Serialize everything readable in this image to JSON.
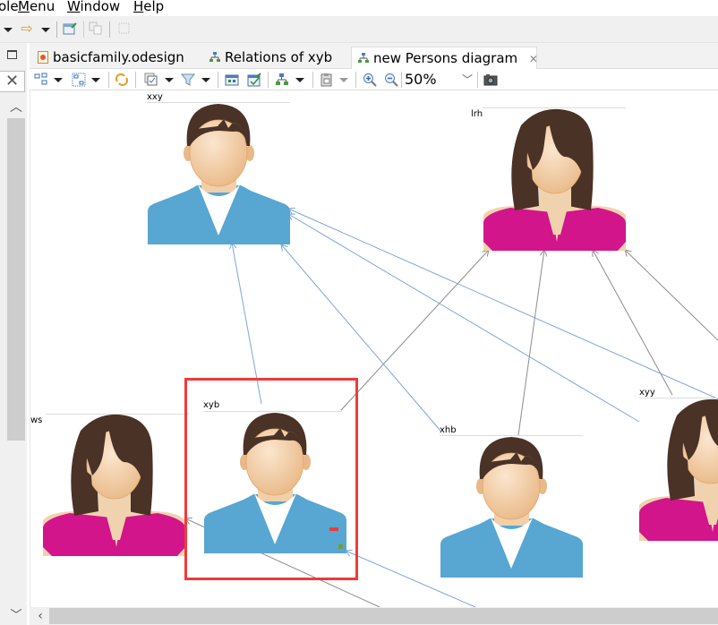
{
  "menu": {
    "items": [
      {
        "label": "ole",
        "prefix": "",
        "underline": "",
        "rest": "ole"
      },
      {
        "label": "Menu",
        "prefix": "",
        "underline": "M",
        "rest": "enu"
      },
      {
        "label": "Window",
        "prefix": "",
        "underline": "W",
        "rest": "indow"
      },
      {
        "label": "Help",
        "prefix": "",
        "underline": "H",
        "rest": "elp"
      }
    ]
  },
  "main_toolbar": {
    "icons": [
      "dropdown-arrow",
      "forward-arrow-icon",
      "dropdown-arrow",
      "new-window-icon",
      "copy-disabled-icon",
      "selection-disabled-icon"
    ]
  },
  "editor_tabs": [
    {
      "label": "basicfamily.odesign",
      "icon": "odesign-file-icon",
      "active": false
    },
    {
      "label": "Relations of xyb",
      "icon": "diagram-icon",
      "active": false
    },
    {
      "label": "new Persons diagram",
      "icon": "diagram-icon",
      "active": true,
      "close": "✕"
    }
  ],
  "diagram_toolbar": {
    "zoom_level": "50%",
    "icons": [
      "arrange-all-icon",
      "arrange-selection-icon",
      "refresh-icon",
      "select-elements-icon",
      "filters-icon",
      "layers-icon",
      "pin-icon",
      "layout-icon",
      "copy-format-icon",
      "zoom-in-icon",
      "zoom-out-icon",
      "export-image-icon"
    ]
  },
  "left_panel": {
    "close_label": "✕"
  },
  "diagram": {
    "nodes": [
      {
        "id": "xxy",
        "label": "xxy",
        "gender": "male",
        "selected": false
      },
      {
        "id": "lrh",
        "label": "lrh",
        "gender": "female",
        "selected": false
      },
      {
        "id": "ws",
        "label": "ws",
        "gender": "female",
        "selected": false
      },
      {
        "id": "xyb",
        "label": "xyb",
        "gender": "male",
        "selected": true
      },
      {
        "id": "xhb",
        "label": "xhb",
        "gender": "male",
        "selected": false
      },
      {
        "id": "xyy",
        "label": "xyy",
        "gender": "female",
        "selected": false
      }
    ],
    "edges": [
      {
        "from": "xyb",
        "to": "xxy",
        "kind": "father"
      },
      {
        "from": "xyb",
        "to": "lrh",
        "kind": "mother"
      },
      {
        "from": "xhb",
        "to": "xxy",
        "kind": "father"
      },
      {
        "from": "xhb",
        "to": "lrh",
        "kind": "mother"
      },
      {
        "from": "xyy",
        "to": "xxy",
        "kind": "father"
      },
      {
        "from": "xyy",
        "to": "lrh",
        "kind": "mother"
      },
      {
        "from": "offscreen-right-1",
        "to": "xxy",
        "kind": "father"
      },
      {
        "from": "offscreen-right-2",
        "to": "lrh",
        "kind": "mother"
      },
      {
        "from": "offscreen-bottom-1",
        "to": "ws",
        "kind": "mother"
      },
      {
        "from": "offscreen-bottom-2",
        "to": "xyb",
        "kind": "father"
      }
    ],
    "colors": {
      "father_edge": "#7ea6d8",
      "mother_edge": "#8c8c8c",
      "selection": "#f03a3a",
      "male_shirt": "#58a6d2",
      "female_shirt": "#d2158a",
      "hair": "#4a3226",
      "skin": "#f1cfa8"
    }
  }
}
